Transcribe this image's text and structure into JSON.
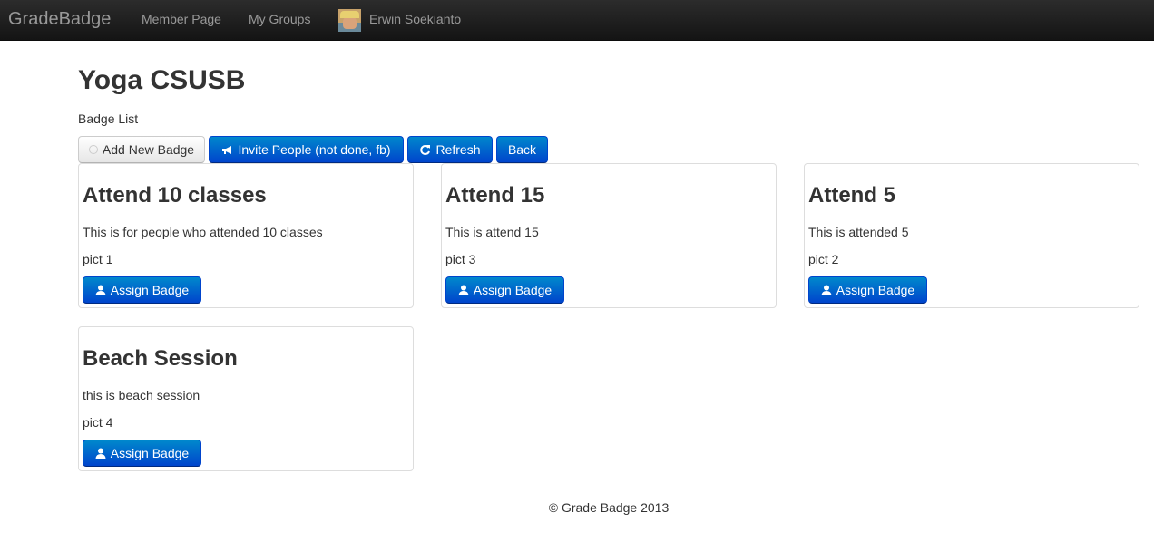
{
  "navbar": {
    "brand": "GradeBadge",
    "links": [
      "Member Page",
      "My Groups"
    ],
    "user_name": "Erwin Soekianto"
  },
  "page": {
    "title": "Yoga CSUSB",
    "subtitle": "Badge List"
  },
  "toolbar": {
    "add_label": "Add New Badge",
    "invite_label": "Invite People (not done, fb)",
    "refresh_label": "Refresh",
    "back_label": "Back"
  },
  "badges": [
    {
      "title": "Attend 10 classes",
      "description": "This is for people who attended 10 classes",
      "pict": "pict 1",
      "button": "Assign Badge"
    },
    {
      "title": "Attend 15",
      "description": "This is attend 15",
      "pict": "pict 3",
      "button": "Assign Badge"
    },
    {
      "title": "Attend 5",
      "description": "This is attended 5",
      "pict": "pict 2",
      "button": "Assign Badge"
    },
    {
      "title": "Beach Session",
      "description": "this is beach session",
      "pict": "pict 4",
      "button": "Assign Badge"
    }
  ],
  "footer": {
    "text": "© Grade Badge 2013"
  },
  "colors": {
    "primary": "#0055cc",
    "navbar": "#1b1b1b"
  },
  "icons": {
    "add": "plus-circle-icon",
    "invite": "bullhorn-icon",
    "refresh": "refresh-icon",
    "assign": "user-icon"
  }
}
